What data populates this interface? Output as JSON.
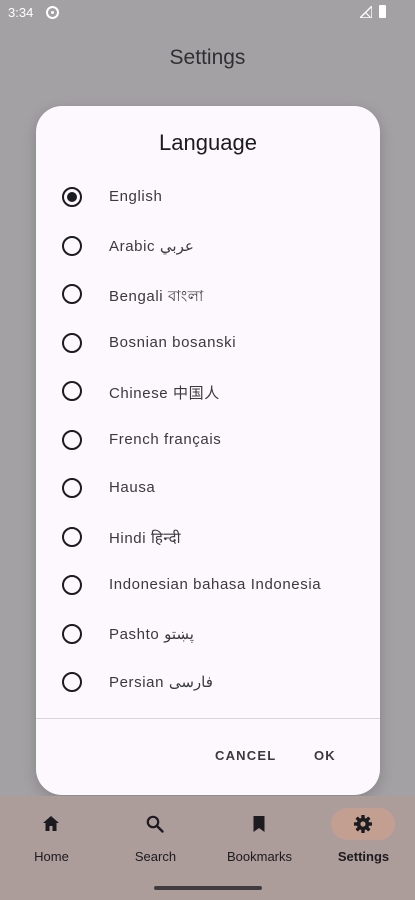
{
  "status_bar": {
    "time": "3:34"
  },
  "page": {
    "title": "Settings"
  },
  "dialog": {
    "title": "Language",
    "options": [
      {
        "label": "English",
        "selected": true
      },
      {
        "label": "Arabic  عربي",
        "selected": false
      },
      {
        "label": "Bengali  বাংলা",
        "selected": false
      },
      {
        "label": "Bosnian  bosanski",
        "selected": false
      },
      {
        "label": "Chinese  中国人",
        "selected": false
      },
      {
        "label": "French  français",
        "selected": false
      },
      {
        "label": "Hausa",
        "selected": false
      },
      {
        "label": "Hindi  हिन्दी",
        "selected": false
      },
      {
        "label": "Indonesian  bahasa Indonesia",
        "selected": false
      },
      {
        "label": "Pashto  پښتو",
        "selected": false
      },
      {
        "label": "Persian  فارسی",
        "selected": false
      }
    ],
    "cancel_label": "CANCEL",
    "ok_label": "OK"
  },
  "bottom_nav": {
    "items": [
      {
        "label": "Home",
        "icon": "home-icon",
        "active": false
      },
      {
        "label": "Search",
        "icon": "search-icon",
        "active": false
      },
      {
        "label": "Bookmarks",
        "icon": "bookmark-icon",
        "active": false
      },
      {
        "label": "Settings",
        "icon": "gear-icon",
        "active": true
      }
    ]
  },
  "colors": {
    "scrim_background": "#a3a1a3",
    "dialog_surface": "#fdf8fd",
    "nav_background": "#ac9c9a",
    "nav_active_pill": "#c39f92"
  }
}
